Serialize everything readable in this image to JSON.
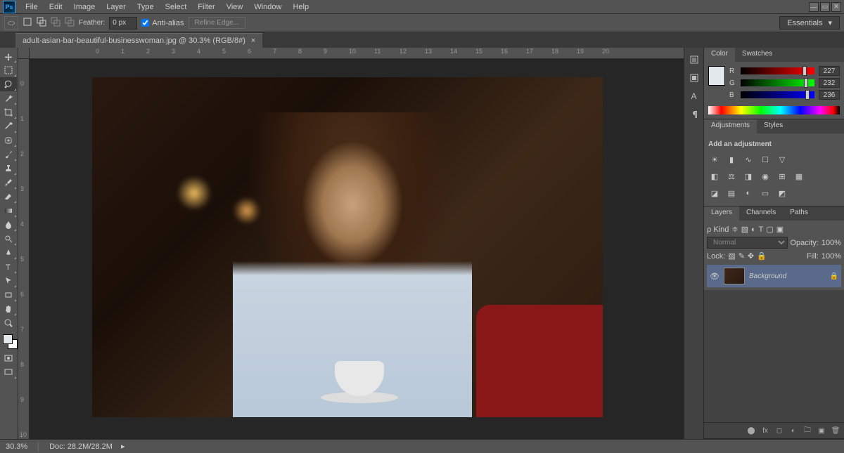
{
  "menubar": {
    "items": [
      "File",
      "Edit",
      "Image",
      "Layer",
      "Type",
      "Select",
      "Filter",
      "View",
      "Window",
      "Help"
    ]
  },
  "optionsbar": {
    "feather_label": "Feather:",
    "feather_value": "0 px",
    "antialias_label": "Anti-alias",
    "refine_label": "Refine Edge...",
    "workspace_label": "Essentials"
  },
  "document": {
    "tab_title": "adult-asian-bar-beautiful-businesswoman.jpg @ 30.3% (RGB/8#)"
  },
  "ruler_marks": [
    "0",
    "1",
    "2",
    "3",
    "4",
    "5",
    "6",
    "7",
    "8",
    "9",
    "10",
    "11",
    "12",
    "13",
    "14",
    "15",
    "16",
    "17",
    "18",
    "19",
    "20"
  ],
  "ruler_marks_v": [
    "0",
    "1",
    "2",
    "3",
    "4",
    "5",
    "6",
    "7",
    "8",
    "9",
    "10"
  ],
  "color_panel": {
    "tabs": [
      "Color",
      "Swatches"
    ],
    "r_label": "R",
    "r_value": "227",
    "g_label": "G",
    "g_value": "232",
    "b_label": "B",
    "b_value": "236"
  },
  "adjustments": {
    "tabs": [
      "Adjustments",
      "Styles"
    ],
    "title": "Add an adjustment"
  },
  "layers": {
    "tabs": [
      "Layers",
      "Channels",
      "Paths"
    ],
    "kind_label": "ρ Kind",
    "blend_mode": "Normal",
    "opacity_label": "Opacity:",
    "opacity_value": "100%",
    "lock_label": "Lock:",
    "fill_label": "Fill:",
    "fill_value": "100%",
    "layer_name": "Background"
  },
  "statusbar": {
    "zoom": "30.3%",
    "doc_info": "Doc: 28.2M/28.2M"
  }
}
